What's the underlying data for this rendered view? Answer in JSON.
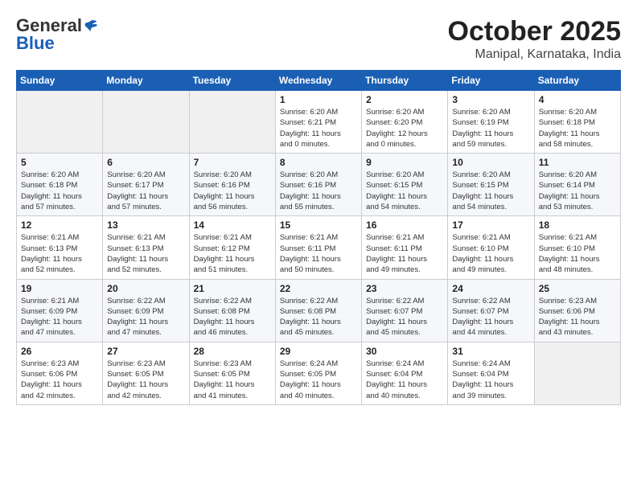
{
  "logo": {
    "general": "General",
    "blue": "Blue"
  },
  "header": {
    "title": "October 2025",
    "subtitle": "Manipal, Karnataka, India"
  },
  "weekdays": [
    "Sunday",
    "Monday",
    "Tuesday",
    "Wednesday",
    "Thursday",
    "Friday",
    "Saturday"
  ],
  "weeks": [
    [
      {
        "day": "",
        "info": ""
      },
      {
        "day": "",
        "info": ""
      },
      {
        "day": "",
        "info": ""
      },
      {
        "day": "1",
        "info": "Sunrise: 6:20 AM\nSunset: 6:21 PM\nDaylight: 11 hours\nand 0 minutes."
      },
      {
        "day": "2",
        "info": "Sunrise: 6:20 AM\nSunset: 6:20 PM\nDaylight: 12 hours\nand 0 minutes."
      },
      {
        "day": "3",
        "info": "Sunrise: 6:20 AM\nSunset: 6:19 PM\nDaylight: 11 hours\nand 59 minutes."
      },
      {
        "day": "4",
        "info": "Sunrise: 6:20 AM\nSunset: 6:18 PM\nDaylight: 11 hours\nand 58 minutes."
      }
    ],
    [
      {
        "day": "5",
        "info": "Sunrise: 6:20 AM\nSunset: 6:18 PM\nDaylight: 11 hours\nand 57 minutes."
      },
      {
        "day": "6",
        "info": "Sunrise: 6:20 AM\nSunset: 6:17 PM\nDaylight: 11 hours\nand 57 minutes."
      },
      {
        "day": "7",
        "info": "Sunrise: 6:20 AM\nSunset: 6:16 PM\nDaylight: 11 hours\nand 56 minutes."
      },
      {
        "day": "8",
        "info": "Sunrise: 6:20 AM\nSunset: 6:16 PM\nDaylight: 11 hours\nand 55 minutes."
      },
      {
        "day": "9",
        "info": "Sunrise: 6:20 AM\nSunset: 6:15 PM\nDaylight: 11 hours\nand 54 minutes."
      },
      {
        "day": "10",
        "info": "Sunrise: 6:20 AM\nSunset: 6:15 PM\nDaylight: 11 hours\nand 54 minutes."
      },
      {
        "day": "11",
        "info": "Sunrise: 6:20 AM\nSunset: 6:14 PM\nDaylight: 11 hours\nand 53 minutes."
      }
    ],
    [
      {
        "day": "12",
        "info": "Sunrise: 6:21 AM\nSunset: 6:13 PM\nDaylight: 11 hours\nand 52 minutes."
      },
      {
        "day": "13",
        "info": "Sunrise: 6:21 AM\nSunset: 6:13 PM\nDaylight: 11 hours\nand 52 minutes."
      },
      {
        "day": "14",
        "info": "Sunrise: 6:21 AM\nSunset: 6:12 PM\nDaylight: 11 hours\nand 51 minutes."
      },
      {
        "day": "15",
        "info": "Sunrise: 6:21 AM\nSunset: 6:11 PM\nDaylight: 11 hours\nand 50 minutes."
      },
      {
        "day": "16",
        "info": "Sunrise: 6:21 AM\nSunset: 6:11 PM\nDaylight: 11 hours\nand 49 minutes."
      },
      {
        "day": "17",
        "info": "Sunrise: 6:21 AM\nSunset: 6:10 PM\nDaylight: 11 hours\nand 49 minutes."
      },
      {
        "day": "18",
        "info": "Sunrise: 6:21 AM\nSunset: 6:10 PM\nDaylight: 11 hours\nand 48 minutes."
      }
    ],
    [
      {
        "day": "19",
        "info": "Sunrise: 6:21 AM\nSunset: 6:09 PM\nDaylight: 11 hours\nand 47 minutes."
      },
      {
        "day": "20",
        "info": "Sunrise: 6:22 AM\nSunset: 6:09 PM\nDaylight: 11 hours\nand 47 minutes."
      },
      {
        "day": "21",
        "info": "Sunrise: 6:22 AM\nSunset: 6:08 PM\nDaylight: 11 hours\nand 46 minutes."
      },
      {
        "day": "22",
        "info": "Sunrise: 6:22 AM\nSunset: 6:08 PM\nDaylight: 11 hours\nand 45 minutes."
      },
      {
        "day": "23",
        "info": "Sunrise: 6:22 AM\nSunset: 6:07 PM\nDaylight: 11 hours\nand 45 minutes."
      },
      {
        "day": "24",
        "info": "Sunrise: 6:22 AM\nSunset: 6:07 PM\nDaylight: 11 hours\nand 44 minutes."
      },
      {
        "day": "25",
        "info": "Sunrise: 6:23 AM\nSunset: 6:06 PM\nDaylight: 11 hours\nand 43 minutes."
      }
    ],
    [
      {
        "day": "26",
        "info": "Sunrise: 6:23 AM\nSunset: 6:06 PM\nDaylight: 11 hours\nand 42 minutes."
      },
      {
        "day": "27",
        "info": "Sunrise: 6:23 AM\nSunset: 6:05 PM\nDaylight: 11 hours\nand 42 minutes."
      },
      {
        "day": "28",
        "info": "Sunrise: 6:23 AM\nSunset: 6:05 PM\nDaylight: 11 hours\nand 41 minutes."
      },
      {
        "day": "29",
        "info": "Sunrise: 6:24 AM\nSunset: 6:05 PM\nDaylight: 11 hours\nand 40 minutes."
      },
      {
        "day": "30",
        "info": "Sunrise: 6:24 AM\nSunset: 6:04 PM\nDaylight: 11 hours\nand 40 minutes."
      },
      {
        "day": "31",
        "info": "Sunrise: 6:24 AM\nSunset: 6:04 PM\nDaylight: 11 hours\nand 39 minutes."
      },
      {
        "day": "",
        "info": ""
      }
    ]
  ]
}
